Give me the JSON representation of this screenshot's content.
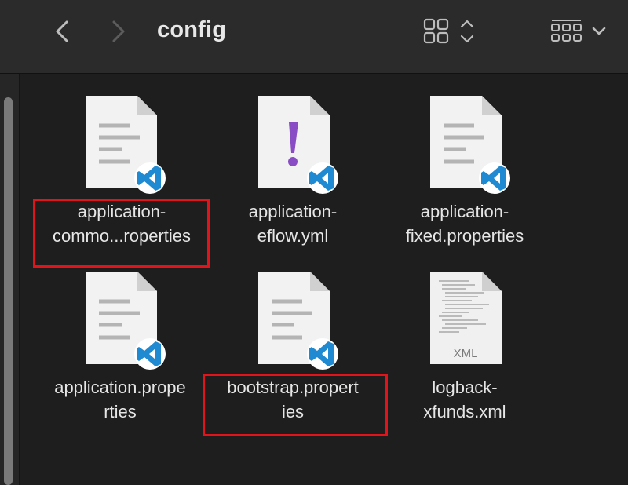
{
  "window": {
    "title": "config"
  },
  "toolbar": {
    "back_icon": "chevron-left-icon",
    "forward_icon": "chevron-right-icon",
    "view_icon": "grid-view-icon",
    "group_icon": "group-by-icon"
  },
  "files": [
    {
      "name_line1": "application-",
      "name_line2": "commo...roperties",
      "icon": "vscode-document-icon",
      "highlighted": true
    },
    {
      "name_line1": "application-",
      "name_line2": "eflow.yml",
      "icon": "vscode-yaml-icon",
      "highlighted": false
    },
    {
      "name_line1": "application-",
      "name_line2": "fixed.properties",
      "icon": "vscode-document-icon",
      "highlighted": false
    },
    {
      "name_line1": "application.prope",
      "name_line2": "rties",
      "icon": "vscode-document-icon",
      "highlighted": false
    },
    {
      "name_line1": "bootstrap.propert",
      "name_line2": "ies",
      "icon": "vscode-document-icon",
      "highlighted": true
    },
    {
      "name_line1": "logback-",
      "name_line2": "xfunds.xml",
      "icon": "xml-file-icon",
      "badge": "XML",
      "highlighted": false
    }
  ],
  "colors": {
    "highlight": "#e0141a",
    "vscode_blue": "#1f8ad2",
    "yaml_purple": "#8a4cc4"
  }
}
